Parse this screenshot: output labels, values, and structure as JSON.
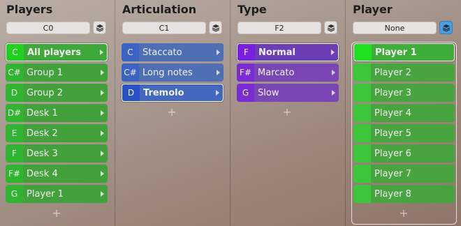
{
  "colors": {
    "green": "#43a13b",
    "blue": "#4e6fb3",
    "purple": "#7a46b3",
    "accent": "#4a9ee0"
  },
  "columns": {
    "players": {
      "title": "Players",
      "selector": "C0",
      "items": [
        {
          "key": "C",
          "label": "All players"
        },
        {
          "key": "C#",
          "label": "Group 1"
        },
        {
          "key": "D",
          "label": "Group 2"
        },
        {
          "key": "D#",
          "label": "Desk 1"
        },
        {
          "key": "E",
          "label": "Desk 2"
        },
        {
          "key": "F",
          "label": "Desk 3"
        },
        {
          "key": "F#",
          "label": "Desk 4"
        },
        {
          "key": "G",
          "label": "Player 1"
        }
      ],
      "add_label": "+"
    },
    "articulation": {
      "title": "Articulation",
      "selector": "C1",
      "items": [
        {
          "key": "C",
          "label": "Staccato"
        },
        {
          "key": "C#",
          "label": "Long notes"
        },
        {
          "key": "D",
          "label": "Tremolo"
        }
      ],
      "add_label": "+"
    },
    "type": {
      "title": "Type",
      "selector": "F2",
      "items": [
        {
          "key": "F",
          "label": "Normal"
        },
        {
          "key": "F#",
          "label": "Marcato"
        },
        {
          "key": "G",
          "label": "Slow"
        }
      ],
      "add_label": "+"
    },
    "player": {
      "title": "Player",
      "selector": "None",
      "items": [
        {
          "label": "Player 1"
        },
        {
          "label": "Player 2"
        },
        {
          "label": "Player 3"
        },
        {
          "label": "Player 4"
        },
        {
          "label": "Player 5"
        },
        {
          "label": "Player 6"
        },
        {
          "label": "Player 7"
        },
        {
          "label": "Player 8"
        }
      ],
      "add_label": "+"
    }
  }
}
